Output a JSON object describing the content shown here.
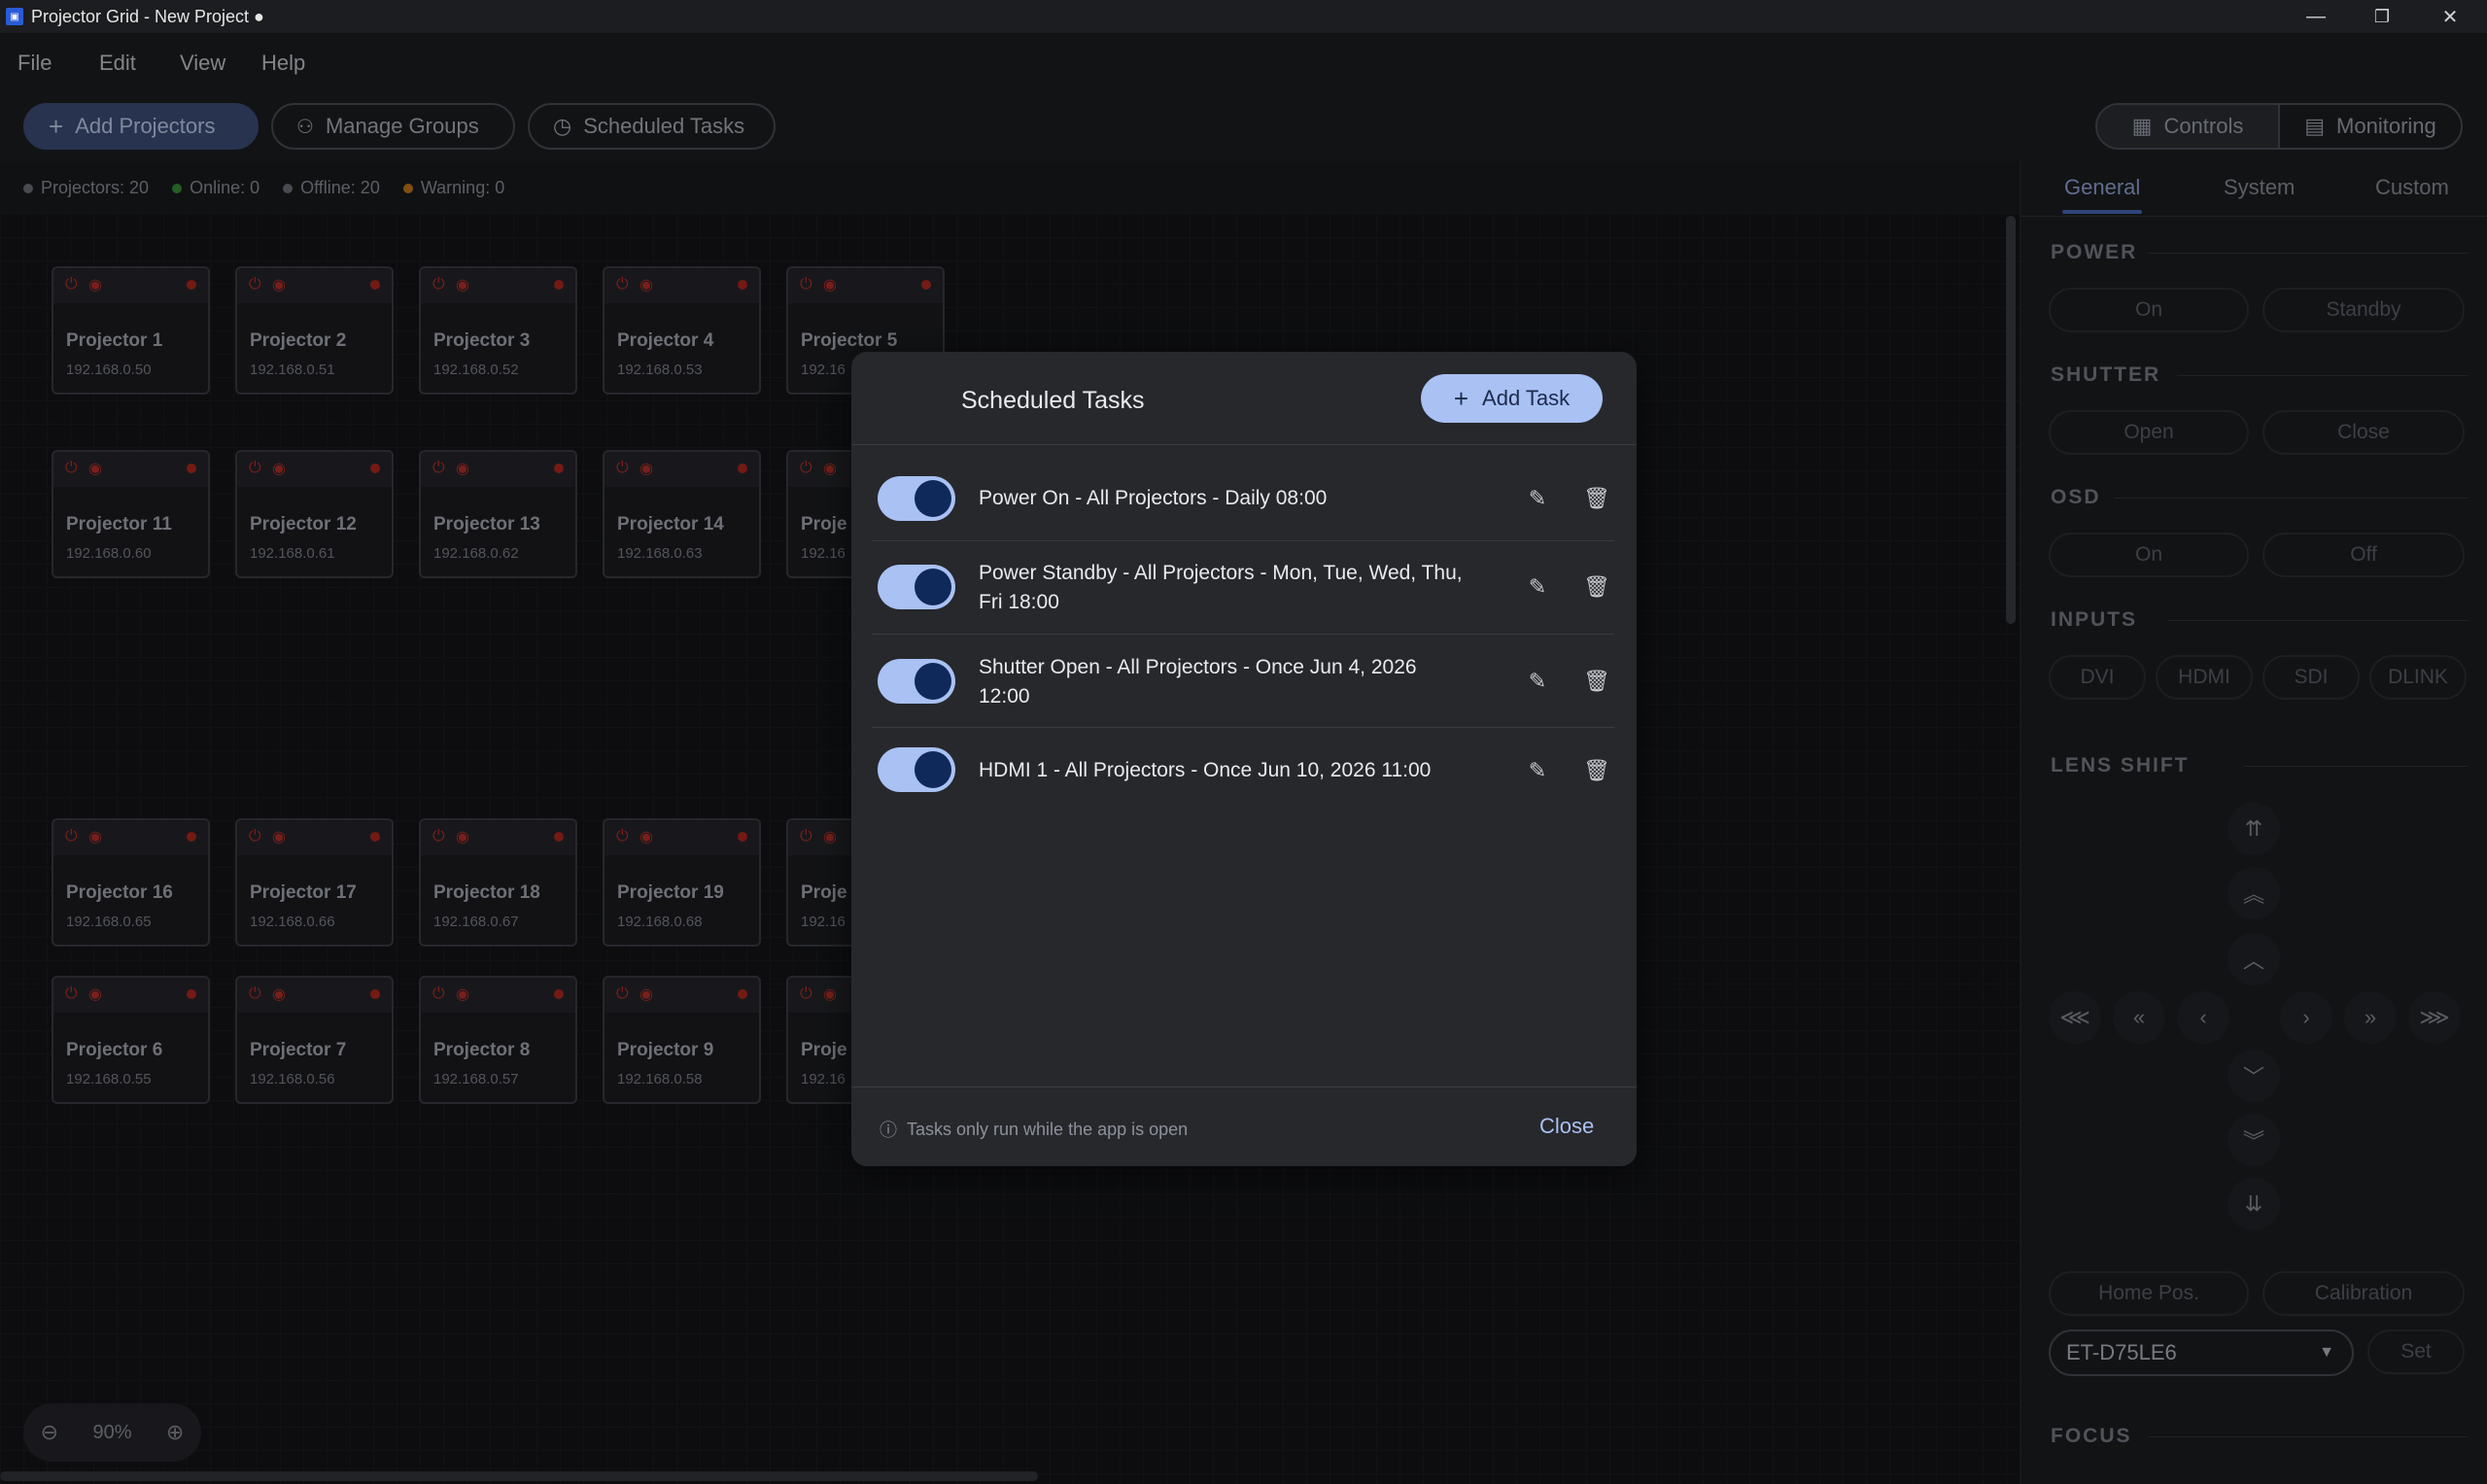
{
  "window": {
    "title": "Projector Grid - New Project ●"
  },
  "menu": [
    "File",
    "Edit",
    "View",
    "Help"
  ],
  "toolbar": {
    "add_projectors": "Add Projectors",
    "manage_groups": "Manage Groups",
    "scheduled_tasks": "Scheduled Tasks",
    "controls": "Controls",
    "monitoring": "Monitoring"
  },
  "status": {
    "projectors": "Projectors: 20",
    "online": "Online: 0",
    "offline": "Offline: 20",
    "warning": "Warning: 0"
  },
  "projectors": [
    {
      "name": "Projector 1",
      "ip": "192.168.0.50"
    },
    {
      "name": "Projector 2",
      "ip": "192.168.0.51"
    },
    {
      "name": "Projector 3",
      "ip": "192.168.0.52"
    },
    {
      "name": "Projector 4",
      "ip": "192.168.0.53"
    },
    {
      "name": "Projector 5",
      "ip": "192.16"
    },
    {
      "name": "Projector 11",
      "ip": "192.168.0.60"
    },
    {
      "name": "Projector 12",
      "ip": "192.168.0.61"
    },
    {
      "name": "Projector 13",
      "ip": "192.168.0.62"
    },
    {
      "name": "Projector 14",
      "ip": "192.168.0.63"
    },
    {
      "name": "Proje",
      "ip": "192.16"
    },
    {
      "name": "Projector 16",
      "ip": "192.168.0.65"
    },
    {
      "name": "Projector 17",
      "ip": "192.168.0.66"
    },
    {
      "name": "Projector 18",
      "ip": "192.168.0.67"
    },
    {
      "name": "Projector 19",
      "ip": "192.168.0.68"
    },
    {
      "name": "Proje",
      "ip": "192.16"
    },
    {
      "name": "Projector 6",
      "ip": "192.168.0.55"
    },
    {
      "name": "Projector 7",
      "ip": "192.168.0.56"
    },
    {
      "name": "Projector 8",
      "ip": "192.168.0.57"
    },
    {
      "name": "Projector 9",
      "ip": "192.168.0.58"
    },
    {
      "name": "Proje",
      "ip": "192.16"
    }
  ],
  "zoom": {
    "level": "90%"
  },
  "right_panel": {
    "tabs": [
      "General",
      "System",
      "Custom"
    ],
    "power": {
      "title": "POWER",
      "on": "On",
      "standby": "Standby"
    },
    "shutter": {
      "title": "SHUTTER",
      "open": "Open",
      "close": "Close"
    },
    "osd": {
      "title": "OSD",
      "on": "On",
      "off": "Off"
    },
    "inputs": {
      "title": "INPUTS",
      "items": [
        "DVI",
        "HDMI",
        "SDI",
        "DLINK"
      ]
    },
    "lens_shift": {
      "title": "LENS SHIFT",
      "home": "Home Pos.",
      "calibration": "Calibration",
      "lens_model": "ET-D75LE6",
      "set": "Set"
    },
    "focus": {
      "title": "FOCUS"
    }
  },
  "dialog": {
    "title": "Scheduled Tasks",
    "add_task": "Add Task",
    "tasks": [
      {
        "line1": "Power On - All Projectors - Daily 08:00",
        "line2": "",
        "enabled": true
      },
      {
        "line1": "Power Standby - All Projectors - Mon, Tue, Wed, Thu,",
        "line2": "Fri 18:00",
        "enabled": true
      },
      {
        "line1": "Shutter Open - All Projectors - Once Jun 4, 2026",
        "line2": "12:00",
        "enabled": true
      },
      {
        "line1": "HDMI 1 - All Projectors - Once Jun 10, 2026 11:00",
        "line2": "",
        "enabled": true
      }
    ],
    "footnote": "Tasks only run while the app is open",
    "close": "Close"
  },
  "colors": {
    "accent": "#a9c1f3",
    "offline_dot": "#b3291f",
    "online_dot": "#3a8f3a",
    "warning_dot": "#c87a1c"
  }
}
